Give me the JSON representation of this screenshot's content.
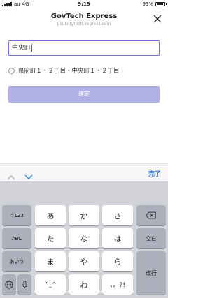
{
  "status_bar": {
    "carrier": "au",
    "network": "4G",
    "time": "9:19",
    "battery": "93%",
    "battery_level": 0.93
  },
  "header": {
    "title": "GovTech Express",
    "url": "pilusotytech.express.com",
    "close_icon": "close-icon"
  },
  "form": {
    "input_value": "中央町",
    "option_label": "県府町１・２丁目・中央町１・２丁目",
    "confirm_label": "確定"
  },
  "keyboard_toolbar": {
    "up_icon": "chevron-up-icon",
    "down_icon": "chevron-down-icon",
    "done_label": "完了"
  },
  "keyboard": {
    "row1": {
      "left": "☆123",
      "k1": "あ",
      "k2": "か",
      "k3": "さ",
      "right_icon": "backspace-icon"
    },
    "row2": {
      "left": "ABC",
      "k1": "た",
      "k2": "な",
      "k3": "は",
      "right": "空白"
    },
    "row3": {
      "left": "あいう",
      "k1": "ま",
      "k2": "や",
      "k3": "ら"
    },
    "row4": {
      "globe_icon": "globe-icon",
      "mic_icon": "mic-icon",
      "k1": "^_^",
      "k2": "わ",
      "k3": "、。?!",
      "enter": "改行"
    }
  }
}
